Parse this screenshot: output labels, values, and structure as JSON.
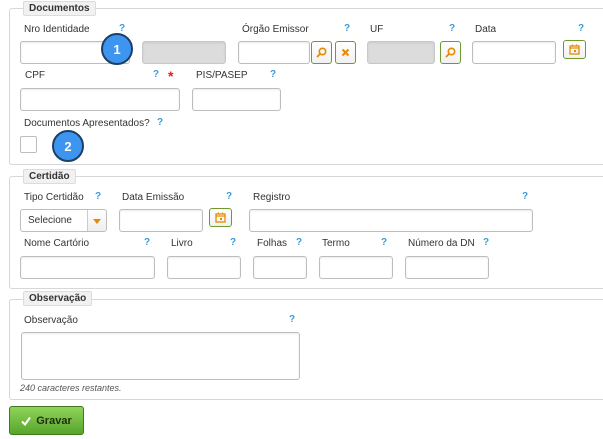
{
  "documentos": {
    "legend": "Documentos",
    "nro_identidade": {
      "label": "Nro Identidade",
      "help": "?",
      "value": "",
      "extra_value": ""
    },
    "orgao_emissor": {
      "label": "Órgão Emissor",
      "help": "?",
      "value": ""
    },
    "uf": {
      "label": "UF",
      "help": "?",
      "value": ""
    },
    "data": {
      "label": "Data",
      "help": "?",
      "value": ""
    },
    "cpf": {
      "label": "CPF",
      "help": "?",
      "required": "*",
      "value": ""
    },
    "pis_pasep": {
      "label": "PIS/PASEP",
      "help": "?",
      "value": ""
    },
    "documentos_apresentados": {
      "label": "Documentos Apresentados?",
      "help": "?"
    }
  },
  "badges": {
    "one": "1",
    "two": "2"
  },
  "certidao": {
    "legend": "Certidão",
    "tipo_certidao": {
      "label": "Tipo Certidão",
      "help": "?",
      "selected": "Selecione"
    },
    "data_emissao": {
      "label": "Data Emissão",
      "help": "?",
      "value": ""
    },
    "registro": {
      "label": "Registro",
      "help": "?",
      "value": ""
    },
    "nome_cartorio": {
      "label": "Nome Cartório",
      "help": "?",
      "value": ""
    },
    "livro": {
      "label": "Livro",
      "help": "?",
      "value": ""
    },
    "folhas": {
      "label": "Folhas",
      "help": "?",
      "value": ""
    },
    "termo": {
      "label": "Termo",
      "help": "?",
      "value": ""
    },
    "numero_dn": {
      "label": "Número da DN",
      "help": "?",
      "value": ""
    }
  },
  "observacao": {
    "legend": "Observação",
    "label": "Observação",
    "help": "?",
    "value": "",
    "remaining": "240 caracteres restantes."
  },
  "actions": {
    "save_label": "Gravar"
  },
  "colors": {
    "accent_green": "#6f9b2e",
    "help_blue": "#3c9bd6",
    "badge_blue": "#3d95f0",
    "required_red": "#e02020"
  }
}
